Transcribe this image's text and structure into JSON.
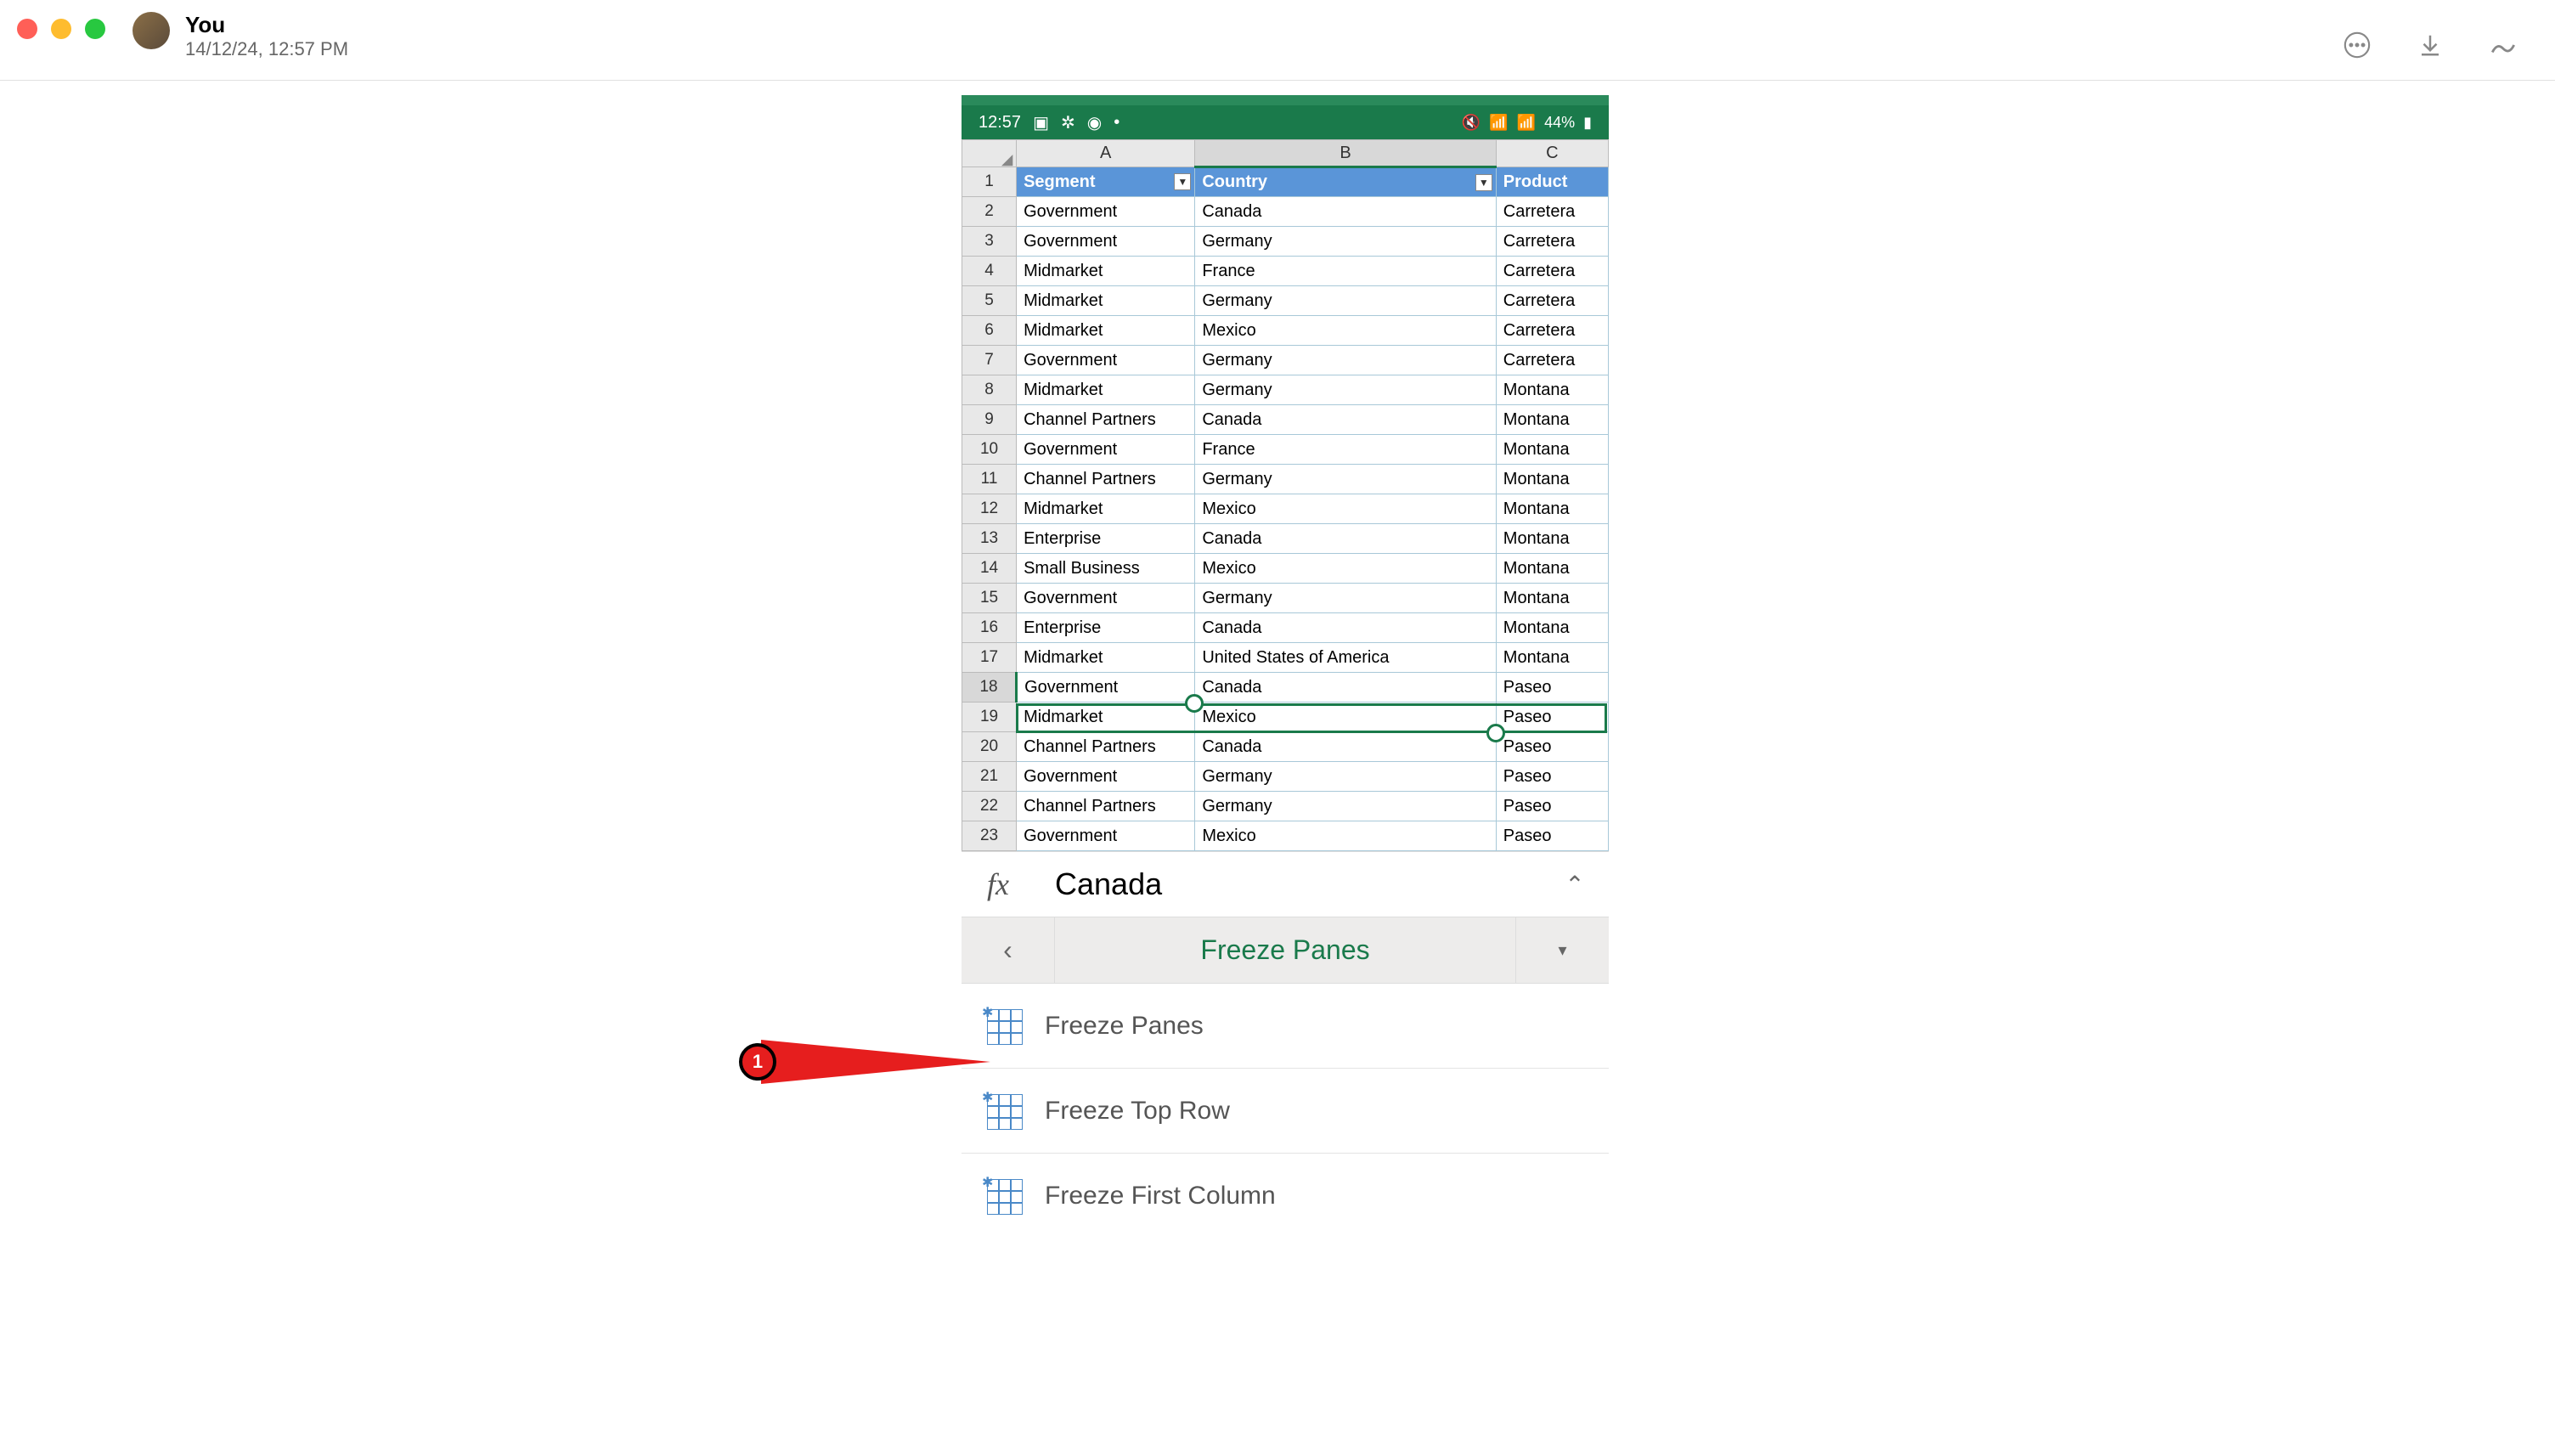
{
  "header": {
    "name": "You",
    "timestamp": "14/12/24, 12:57 PM"
  },
  "statusbar": {
    "time": "12:57",
    "battery": "44%"
  },
  "sheet": {
    "columns": [
      "A",
      "B",
      "C"
    ],
    "header_row": {
      "A": "Segment",
      "B": "Country",
      "C": "Product"
    },
    "rows": [
      {
        "n": "1",
        "A": "Segment",
        "B": "Country",
        "C": "Product"
      },
      {
        "n": "2",
        "A": "Government",
        "B": "Canada",
        "C": "Carretera"
      },
      {
        "n": "3",
        "A": "Government",
        "B": "Germany",
        "C": "Carretera"
      },
      {
        "n": "4",
        "A": "Midmarket",
        "B": "France",
        "C": "Carretera"
      },
      {
        "n": "5",
        "A": "Midmarket",
        "B": "Germany",
        "C": "Carretera"
      },
      {
        "n": "6",
        "A": "Midmarket",
        "B": "Mexico",
        "C": "Carretera"
      },
      {
        "n": "7",
        "A": "Government",
        "B": "Germany",
        "C": "Carretera"
      },
      {
        "n": "8",
        "A": "Midmarket",
        "B": "Germany",
        "C": "Montana"
      },
      {
        "n": "9",
        "A": "Channel Partners",
        "B": "Canada",
        "C": "Montana"
      },
      {
        "n": "10",
        "A": "Government",
        "B": "France",
        "C": "Montana"
      },
      {
        "n": "11",
        "A": "Channel Partners",
        "B": "Germany",
        "C": "Montana"
      },
      {
        "n": "12",
        "A": "Midmarket",
        "B": "Mexico",
        "C": "Montana"
      },
      {
        "n": "13",
        "A": "Enterprise",
        "B": "Canada",
        "C": "Montana"
      },
      {
        "n": "14",
        "A": "Small Business",
        "B": "Mexico",
        "C": "Montana"
      },
      {
        "n": "15",
        "A": "Government",
        "B": "Germany",
        "C": "Montana"
      },
      {
        "n": "16",
        "A": "Enterprise",
        "B": "Canada",
        "C": "Montana"
      },
      {
        "n": "17",
        "A": "Midmarket",
        "B": "United States of America",
        "C": "Montana"
      },
      {
        "n": "18",
        "A": "Government",
        "B": "Canada",
        "C": "Paseo"
      },
      {
        "n": "19",
        "A": "Midmarket",
        "B": "Mexico",
        "C": "Paseo"
      },
      {
        "n": "20",
        "A": "Channel Partners",
        "B": "Canada",
        "C": "Paseo"
      },
      {
        "n": "21",
        "A": "Government",
        "B": "Germany",
        "C": "Paseo"
      },
      {
        "n": "22",
        "A": "Channel Partners",
        "B": "Germany",
        "C": "Paseo"
      },
      {
        "n": "23",
        "A": "Government",
        "B": "Mexico",
        "C": "Paseo"
      }
    ],
    "selected_row": "18",
    "selected_col": "B"
  },
  "formula": {
    "fx_label": "fx",
    "value": "Canada"
  },
  "freeze_panes": {
    "title": "Freeze Panes",
    "options": [
      {
        "label": "Freeze Panes"
      },
      {
        "label": "Freeze Top Row"
      },
      {
        "label": "Freeze First Column"
      }
    ]
  },
  "annotation": {
    "number": "1"
  }
}
